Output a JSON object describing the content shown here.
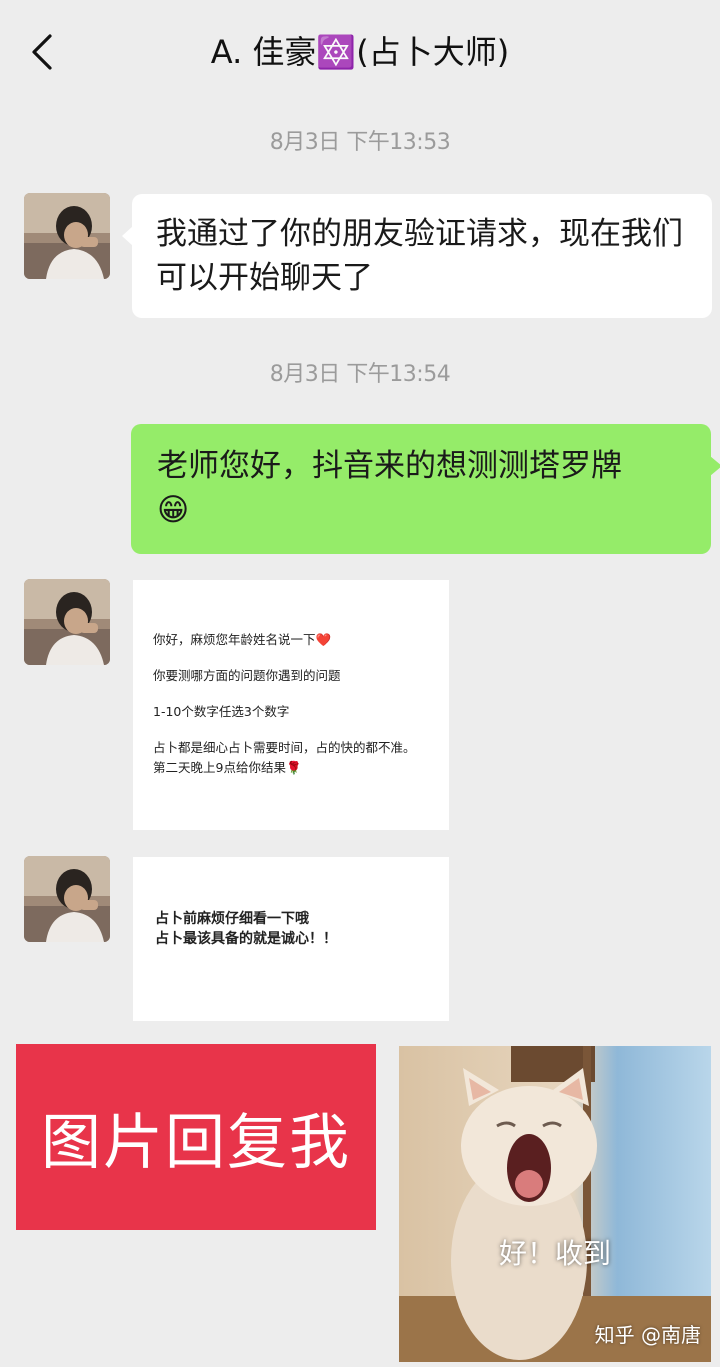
{
  "header": {
    "title": "A. 佳豪🔯(占卜大师)"
  },
  "timestamps": [
    "8月3日 下午13:53",
    "8月3日 下午13:54"
  ],
  "messages": {
    "m1": "我通过了你的朋友验证请求，现在我们可以开始聊天了",
    "m2_text": "老师您好，抖音来的想测测塔罗牌",
    "m2_emoji": "😁",
    "img1": {
      "lines": [
        "你好，麻烦您年龄姓名说一下❤️",
        "你要测哪方面的问题你遇到的问题",
        "1-10个数字任选3个数字",
        "占卜都是细心占卜需要时间，占的快的都不准。",
        "第二天晚上9点给你结果🌹"
      ]
    },
    "img2": {
      "lines": [
        "占卜前麻烦仔细看一下哦",
        "占卜最该具备的就是诚心！！"
      ]
    }
  },
  "overlay": {
    "red_card_text": "图片回复我",
    "cat_caption": "好！收到",
    "watermark": "知乎 @南唐"
  },
  "icons": {
    "back": "chevron-left-icon"
  }
}
